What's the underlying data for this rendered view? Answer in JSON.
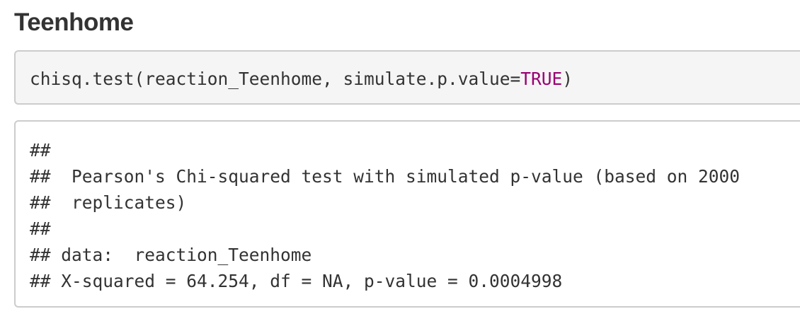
{
  "section": {
    "heading": "Teenhome"
  },
  "code_chunk": {
    "code_prefix": "chisq.test(reaction_Teenhome, simulate.p.value=",
    "code_keyword": "TRUE",
    "code_suffix": ")",
    "keyword_color": "#990073"
  },
  "output_chunk": {
    "lines": [
      "##",
      "##  Pearson's Chi-squared test with simulated p-value (based on 2000",
      "##  replicates)",
      "##",
      "## data:  reaction_Teenhome",
      "## X-squared = 64.254, df = NA, p-value = 0.0004998"
    ]
  }
}
